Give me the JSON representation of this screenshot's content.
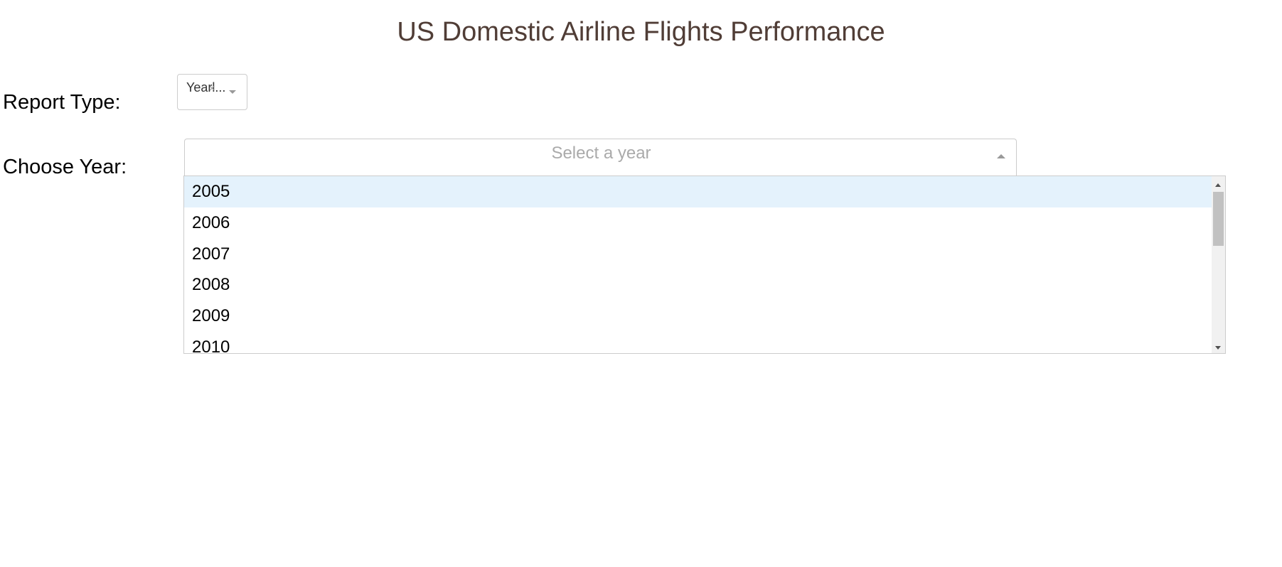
{
  "page": {
    "title": "US Domestic Airline Flights Performance"
  },
  "report_type": {
    "label": "Report Type:",
    "value": "Yearl...",
    "clear_icon": "×"
  },
  "year": {
    "label": "Choose Year:",
    "placeholder": "Select a year",
    "options": [
      "2005",
      "2006",
      "2007",
      "2008",
      "2009",
      "2010"
    ],
    "focused_option": "2005"
  },
  "colors": {
    "title": "#503D36",
    "focused_option_bg": "#e4f2fc",
    "placeholder": "#aaaaaa"
  },
  "icons": {
    "report_arrow": "chevron-down-icon",
    "year_arrow": "chevron-up-icon",
    "report_clear": "clear-icon"
  }
}
